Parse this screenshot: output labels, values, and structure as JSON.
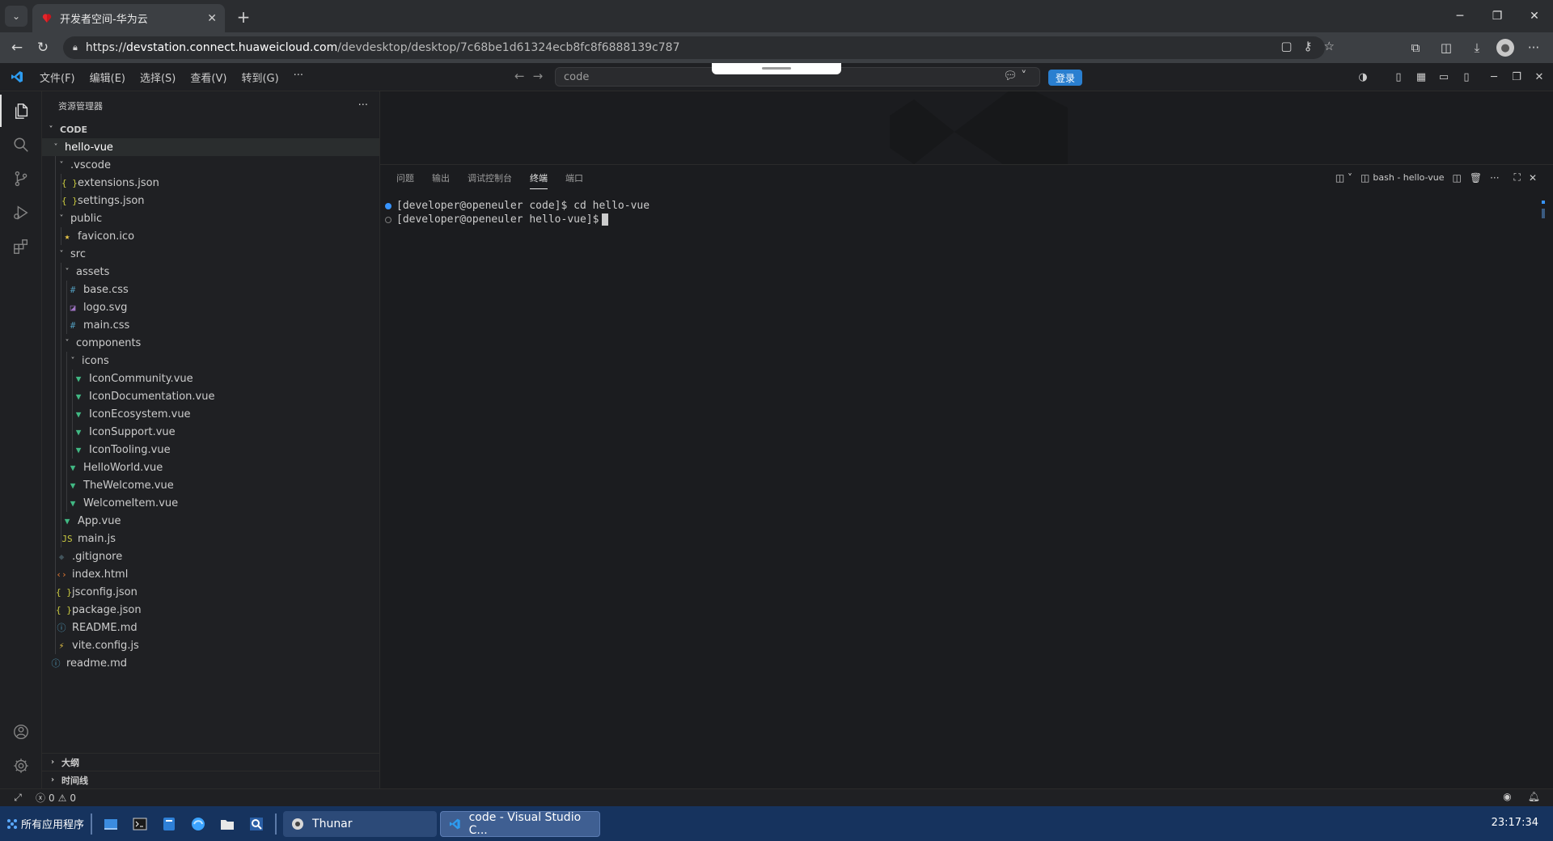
{
  "browser": {
    "tab_title": "开发者空间-华为云",
    "url_prefix": "https://",
    "url_host": "devstation.connect.huaweicloud.com",
    "url_path": "/devdesktop/desktop/7c68be1d61324ecb8fc8f6888139c787"
  },
  "vscode": {
    "menu": [
      "文件(F)",
      "编辑(E)",
      "选择(S)",
      "查看(V)",
      "转到(G)",
      "···"
    ],
    "command_center": "code",
    "login_label": "登录",
    "explorer_title": "资源管理器",
    "explorer_more": "···",
    "root_section": "CODE",
    "tree": [
      {
        "label": "hello-vue",
        "depth": 0,
        "type": "folder",
        "open": true,
        "selected": true
      },
      {
        "label": ".vscode",
        "depth": 1,
        "type": "folder",
        "open": true
      },
      {
        "label": "extensions.json",
        "depth": 2,
        "type": "json"
      },
      {
        "label": "settings.json",
        "depth": 2,
        "type": "json"
      },
      {
        "label": "public",
        "depth": 1,
        "type": "folder",
        "open": true
      },
      {
        "label": "favicon.ico",
        "depth": 2,
        "type": "ico"
      },
      {
        "label": "src",
        "depth": 1,
        "type": "folder",
        "open": true
      },
      {
        "label": "assets",
        "depth": 2,
        "type": "folder",
        "open": true
      },
      {
        "label": "base.css",
        "depth": 3,
        "type": "css"
      },
      {
        "label": "logo.svg",
        "depth": 3,
        "type": "svg"
      },
      {
        "label": "main.css",
        "depth": 3,
        "type": "css"
      },
      {
        "label": "components",
        "depth": 2,
        "type": "folder",
        "open": true
      },
      {
        "label": "icons",
        "depth": 3,
        "type": "folder",
        "open": true
      },
      {
        "label": "IconCommunity.vue",
        "depth": 4,
        "type": "vue"
      },
      {
        "label": "IconDocumentation.vue",
        "depth": 4,
        "type": "vue"
      },
      {
        "label": "IconEcosystem.vue",
        "depth": 4,
        "type": "vue"
      },
      {
        "label": "IconSupport.vue",
        "depth": 4,
        "type": "vue"
      },
      {
        "label": "IconTooling.vue",
        "depth": 4,
        "type": "vue"
      },
      {
        "label": "HelloWorld.vue",
        "depth": 3,
        "type": "vue"
      },
      {
        "label": "TheWelcome.vue",
        "depth": 3,
        "type": "vue"
      },
      {
        "label": "WelcomeItem.vue",
        "depth": 3,
        "type": "vue"
      },
      {
        "label": "App.vue",
        "depth": 2,
        "type": "vue"
      },
      {
        "label": "main.js",
        "depth": 2,
        "type": "js"
      },
      {
        "label": ".gitignore",
        "depth": 1,
        "type": "git"
      },
      {
        "label": "index.html",
        "depth": 1,
        "type": "html"
      },
      {
        "label": "jsconfig.json",
        "depth": 1,
        "type": "json"
      },
      {
        "label": "package.json",
        "depth": 1,
        "type": "json"
      },
      {
        "label": "README.md",
        "depth": 1,
        "type": "info"
      },
      {
        "label": "vite.config.js",
        "depth": 1,
        "type": "vite"
      },
      {
        "label": "readme.md",
        "depth": 0,
        "type": "info"
      }
    ],
    "outline_label": "大纲",
    "timeline_label": "时间线",
    "panel_tabs": [
      "问题",
      "输出",
      "调试控制台",
      "终端",
      "端口"
    ],
    "active_panel_tab": 3,
    "terminal_name": "bash - hello-vue",
    "terminal_lines": [
      "[developer@openeuler code]$ cd hello-vue",
      "[developer@openeuler hello-vue]$"
    ],
    "status": {
      "errors": "0",
      "warnings": "0"
    }
  },
  "taskbar": {
    "start_label": "所有应用程序",
    "tasks": [
      "Thunar",
      "code - Visual Studio C..."
    ],
    "clock": "23:17:34"
  },
  "colors": {
    "accent": "#3794ff",
    "vue": "#41b883",
    "json": "#cbcb41",
    "css": "#519aba",
    "js": "#cbcb41",
    "html": "#e37933",
    "taskbar": "#16335e",
    "login": "#2a7fd0"
  }
}
